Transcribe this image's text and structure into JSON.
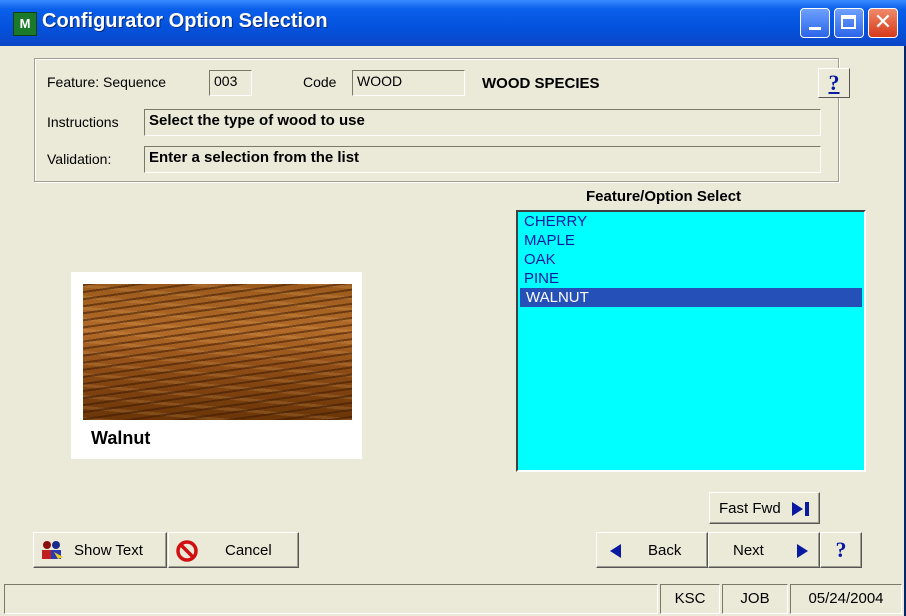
{
  "window": {
    "title": "Configurator Option Selection",
    "app_icon": "configurator-app-icon",
    "close_glyph": "✕"
  },
  "feature": {
    "sequence_label": "Feature: Sequence",
    "sequence_value": "003",
    "code_label": "Code",
    "code_value": "WOOD",
    "code_description": "WOOD SPECIES",
    "help_label": "?",
    "instructions_label": "Instructions",
    "instructions_value": "Select the type of wood to use",
    "validation_label": "Validation:",
    "validation_value": "Enter a selection from the list"
  },
  "preview": {
    "caption": "Walnut",
    "swatch_icon": "walnut-wood-texture"
  },
  "option_list": {
    "title": "Feature/Option Select",
    "items": [
      "CHERRY",
      "MAPLE",
      "OAK",
      "PINE",
      "WALNUT"
    ],
    "selected": "WALNUT",
    "background": "#00ffff",
    "selection_color": "#2550b8"
  },
  "buttons": {
    "fast_fwd": "Fast Fwd",
    "show_text": "Show Text",
    "cancel": "Cancel",
    "back": "Back",
    "next": "Next",
    "help": "?"
  },
  "status_bar": {
    "message": "",
    "user": "KSC",
    "module": "JOB",
    "date": "05/24/2004"
  },
  "colors": {
    "titlebar": "#0452dd",
    "face": "#ebe9d8",
    "link_blue": "#0a1aa0"
  }
}
